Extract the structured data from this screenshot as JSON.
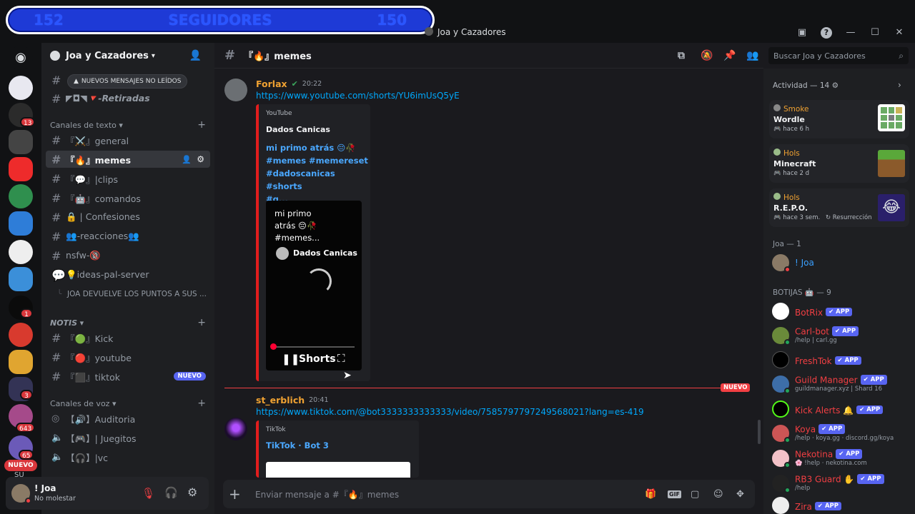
{
  "overlay": {
    "left_num": "152",
    "label": "SEGUIDORES",
    "right_num": "150"
  },
  "window": {
    "title": "Joa y Cazadores"
  },
  "server_rail": {
    "badges": [
      {
        "value": "13"
      },
      {
        "value": "1"
      },
      {
        "value": "3"
      },
      {
        "value": "643"
      },
      {
        "value": "65"
      }
    ],
    "new_pill": "NUEVO",
    "bottom_partial": "SU"
  },
  "guild": {
    "name": "Joa y Cazadores"
  },
  "unread_pill": "NUEVOS MENSAJES NO LEÍDOS",
  "channels_top": [
    {
      "name": "『"
    },
    {
      "name": "◤◘◥🔻-Retiradas"
    }
  ],
  "categories": {
    "text": "Canales de texto",
    "notis": "NOTIS",
    "voice": "Canales de voz"
  },
  "text_channels": [
    {
      "name": "『⚔️』general"
    },
    {
      "name": "『🔥』memes"
    },
    {
      "name": "『💬』|clips"
    },
    {
      "name": "『🤖』comandos"
    },
    {
      "name": "🔒 | Confesiones"
    },
    {
      "name": "👥-reacciones👥"
    },
    {
      "name": "nsfw-🔞"
    },
    {
      "name": "💡ideas-pal-server"
    },
    {
      "name": "JOA DEVUELVE LOS PUNTOS A SUS ..."
    }
  ],
  "notis_channels": [
    {
      "name": "『🟢』Kick"
    },
    {
      "name": "『🔴』youtube"
    },
    {
      "name": "『⬛』tiktok",
      "badge": "NUEVO"
    }
  ],
  "voice_channels": [
    {
      "name": "【🔊】Auditoria"
    },
    {
      "name": "【🎮】| Juegitos"
    },
    {
      "name": "【🎧】|vc"
    }
  ],
  "user": {
    "name": "! Joa",
    "status": "No molestar"
  },
  "channel_header": {
    "name": "『🔥』memes"
  },
  "search": {
    "placeholder": "Buscar Joa y Cazadores"
  },
  "messages": [
    {
      "author": "Forlax",
      "author_color": "#f0a232",
      "time": "20:22",
      "link": "https://www.youtube.com/shorts/YU6imUsQ5yE",
      "embed": {
        "provider": "YouTube",
        "title": "Dados Canicas",
        "desc_lines": [
          "mi primo atrás 😔🥀",
          "#memes #memereset",
          "#dadoscanicas #shorts",
          "#g..."
        ],
        "video_caption_lines": [
          "mi primo",
          "atrás 😔🥀",
          "#memes..."
        ],
        "video_channel": "Dados Canicas",
        "shorts_label": "Shorts"
      }
    },
    {
      "author": "st_erblich",
      "author_color": "#f0a232",
      "time": "20:41",
      "link": "https://www.tiktok.com/@bot3333333333333/video/7585797797249568021?lang=es-419",
      "embed": {
        "provider": "TikTok",
        "title": "TikTok · Bot 3"
      }
    }
  ],
  "new_divider": "NUEVO",
  "composer": {
    "placeholder": "Enviar mensaje a #『🔥』memes"
  },
  "activity": {
    "header": "Actividad — 14",
    "cards": [
      {
        "user": "Smoke",
        "game": "Wordle",
        "time": "hace 6 h",
        "extra": ""
      },
      {
        "user": "Hols",
        "game": "Minecraft",
        "time": "hace 2 d",
        "extra": ""
      },
      {
        "user": "Hols",
        "game": "R.E.P.O.",
        "time": "hace 3 sem.",
        "extra": "Resurrección"
      }
    ]
  },
  "members": {
    "joa_header": "Joa — 1",
    "joa_member": "! Joa",
    "bots_header": "BOTIJAS 🤖 — 9",
    "app_tag": "APP",
    "bots": [
      {
        "name": "BotRix",
        "sub": ""
      },
      {
        "name": "Carl-bot",
        "sub": "/help | carl.gg"
      },
      {
        "name": "FreshTok",
        "sub": ""
      },
      {
        "name": "Guild Manager",
        "sub": "guildmanager.xyz | Shard 16"
      },
      {
        "name": "Kick Alerts 🔔",
        "sub": ""
      },
      {
        "name": "Koya",
        "sub": "/help · koya.gg · discord.gg/koya"
      },
      {
        "name": "Nekotina",
        "sub": "🌸 !help · nekotina.com"
      },
      {
        "name": "RB3 Guard ✋",
        "sub": "/help"
      },
      {
        "name": "Zira",
        "sub": ""
      }
    ]
  },
  "colors": {
    "accent": "#5865f2",
    "danger": "#f23f43",
    "link": "#00a8fc",
    "youtube_red": "#e11d1d"
  }
}
